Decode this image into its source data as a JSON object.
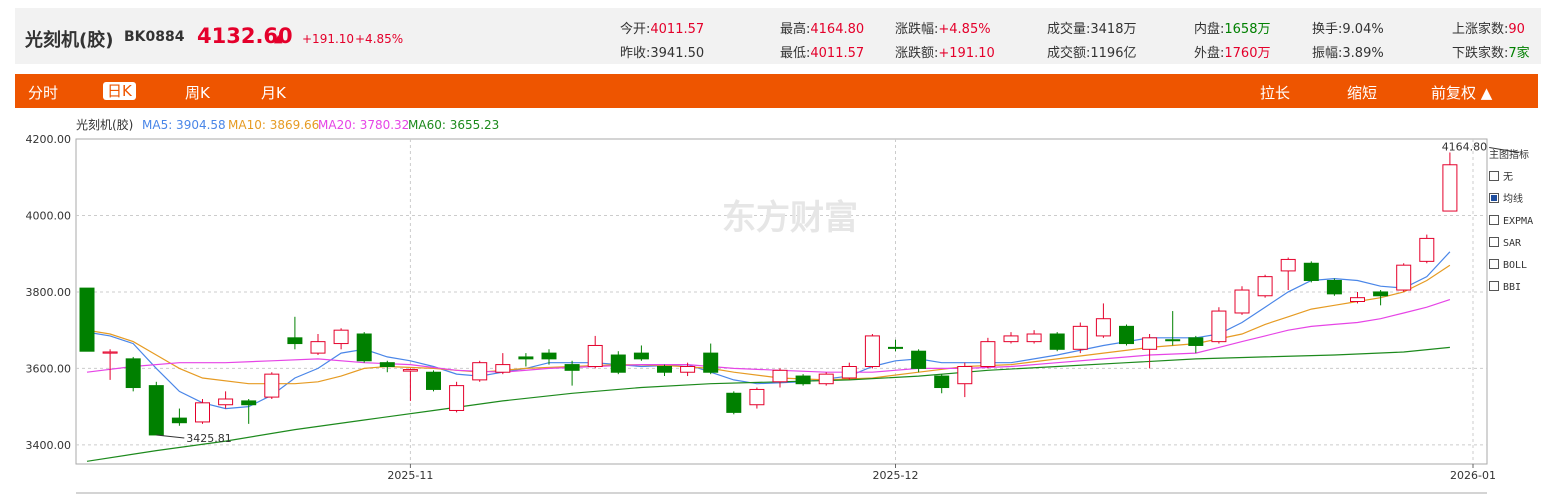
{
  "header": {
    "name": "光刻机(胶)",
    "code": "BK0884",
    "price": "4132.60",
    "arrow": "▲",
    "change": "+191.10",
    "change_pct": "+4.85%",
    "stats": [
      {
        "label": "今开:",
        "value": "4011.57",
        "tone": "red"
      },
      {
        "label": "昨收:",
        "value": "3941.50",
        "tone": "blk"
      },
      {
        "label": "最高:",
        "value": "4164.80",
        "tone": "red"
      },
      {
        "label": "最低:",
        "value": "4011.57",
        "tone": "red"
      },
      {
        "label": "涨跌幅:",
        "value": "+4.85%",
        "tone": "red"
      },
      {
        "label": "涨跌额:",
        "value": "+191.10",
        "tone": "red"
      },
      {
        "label": "成交量:",
        "value": "3418万",
        "tone": "blk"
      },
      {
        "label": "成交额:",
        "value": "1196亿",
        "tone": "blk"
      },
      {
        "label": "内盘:",
        "value": "1658万",
        "tone": "grn"
      },
      {
        "label": "外盘:",
        "value": "1760万",
        "tone": "red"
      },
      {
        "label": "换手:",
        "value": "9.04%",
        "tone": "blk"
      },
      {
        "label": "振幅:",
        "value": "3.89%",
        "tone": "blk"
      },
      {
        "label": "上涨家数:",
        "value": "90",
        "tone": "red"
      },
      {
        "label": "下跌家数:",
        "value": "7家",
        "tone": "grn"
      }
    ]
  },
  "tabs": {
    "left": [
      "分时",
      "日K",
      "周K",
      "月K"
    ],
    "active": "日K",
    "right": [
      "拉长",
      "缩短",
      "前复权 ▲"
    ]
  },
  "legend": {
    "name": "光刻机(胶)",
    "items": [
      {
        "label": "MA5: 3904.58",
        "color": "#4a86e8"
      },
      {
        "label": "MA10: 3869.66",
        "color": "#e69b23"
      },
      {
        "label": "MA20: 3780.32",
        "color": "#e645e6"
      },
      {
        "label": "MA60: 3655.23",
        "color": "#1d8a1d"
      }
    ]
  },
  "watermark": "东方财富",
  "panel": {
    "title": "主图指标",
    "options": [
      {
        "label": "无",
        "checked": false
      },
      {
        "label": "均线",
        "checked": true
      },
      {
        "label": "EXPMA",
        "checked": false
      },
      {
        "label": "SAR",
        "checked": false
      },
      {
        "label": "BOLL",
        "checked": false
      },
      {
        "label": "BBI",
        "checked": false
      }
    ]
  },
  "colors": {
    "up": "#e4002b",
    "down": "#008000",
    "accent": "#ee5500"
  },
  "chart_data": {
    "type": "candlestick",
    "ylim": [
      3350,
      4200
    ],
    "yticks": [
      3400,
      3600,
      3800,
      4000,
      4200
    ],
    "ytick_labels": [
      "3400.00",
      "3600.00",
      "3800.00",
      "4000.00",
      "4200.00"
    ],
    "xtick_labels": [
      {
        "label": "2025-11",
        "index": 14
      },
      {
        "label": "2025-12",
        "index": 35
      },
      {
        "label": "2026-01",
        "index": 60
      }
    ],
    "annotations": [
      {
        "text": "3425.81",
        "index": 3,
        "value": 3425.81
      },
      {
        "text": "4164.80",
        "index": 62,
        "value": 4164.8
      }
    ],
    "candles": [
      {
        "o": 3810,
        "c": 3645,
        "h": 3810,
        "l": 3645
      },
      {
        "o": 3640,
        "c": 3643,
        "h": 3650,
        "l": 3570
      },
      {
        "o": 3625,
        "c": 3550,
        "h": 3630,
        "l": 3540
      },
      {
        "o": 3555,
        "c": 3426,
        "h": 3565,
        "l": 3426
      },
      {
        "o": 3470,
        "c": 3458,
        "h": 3495,
        "l": 3450
      },
      {
        "o": 3460,
        "c": 3510,
        "h": 3520,
        "l": 3455
      },
      {
        "o": 3505,
        "c": 3520,
        "h": 3540,
        "l": 3495
      },
      {
        "o": 3515,
        "c": 3505,
        "h": 3520,
        "l": 3455
      },
      {
        "o": 3525,
        "c": 3585,
        "h": 3590,
        "l": 3520
      },
      {
        "o": 3680,
        "c": 3665,
        "h": 3735,
        "l": 3650
      },
      {
        "o": 3640,
        "c": 3670,
        "h": 3690,
        "l": 3635
      },
      {
        "o": 3665,
        "c": 3700,
        "h": 3705,
        "l": 3650
      },
      {
        "o": 3690,
        "c": 3620,
        "h": 3695,
        "l": 3615
      },
      {
        "o": 3615,
        "c": 3605,
        "h": 3620,
        "l": 3590
      },
      {
        "o": 3593,
        "c": 3597,
        "h": 3600,
        "l": 3515
      },
      {
        "o": 3590,
        "c": 3545,
        "h": 3595,
        "l": 3540
      },
      {
        "o": 3490,
        "c": 3555,
        "h": 3565,
        "l": 3485
      },
      {
        "o": 3570,
        "c": 3615,
        "h": 3620,
        "l": 3565
      },
      {
        "o": 3590,
        "c": 3610,
        "h": 3640,
        "l": 3585
      },
      {
        "o": 3630,
        "c": 3625,
        "h": 3640,
        "l": 3605
      },
      {
        "o": 3640,
        "c": 3625,
        "h": 3650,
        "l": 3610
      },
      {
        "o": 3610,
        "c": 3595,
        "h": 3620,
        "l": 3555
      },
      {
        "o": 3605,
        "c": 3660,
        "h": 3685,
        "l": 3600
      },
      {
        "o": 3635,
        "c": 3590,
        "h": 3645,
        "l": 3585
      },
      {
        "o": 3640,
        "c": 3625,
        "h": 3660,
        "l": 3620
      },
      {
        "o": 3605,
        "c": 3590,
        "h": 3610,
        "l": 3580
      },
      {
        "o": 3590,
        "c": 3605,
        "h": 3615,
        "l": 3580
      },
      {
        "o": 3640,
        "c": 3590,
        "h": 3665,
        "l": 3585
      },
      {
        "o": 3535,
        "c": 3485,
        "h": 3540,
        "l": 3480
      },
      {
        "o": 3505,
        "c": 3545,
        "h": 3550,
        "l": 3495
      },
      {
        "o": 3565,
        "c": 3595,
        "h": 3600,
        "l": 3550
      },
      {
        "o": 3580,
        "c": 3560,
        "h": 3585,
        "l": 3555
      },
      {
        "o": 3560,
        "c": 3585,
        "h": 3590,
        "l": 3555
      },
      {
        "o": 3575,
        "c": 3605,
        "h": 3615,
        "l": 3570
      },
      {
        "o": 3605,
        "c": 3685,
        "h": 3690,
        "l": 3600
      },
      {
        "o": 3655,
        "c": 3653,
        "h": 3675,
        "l": 3645
      },
      {
        "o": 3645,
        "c": 3600,
        "h": 3650,
        "l": 3590
      },
      {
        "o": 3580,
        "c": 3550,
        "h": 3585,
        "l": 3535
      },
      {
        "o": 3560,
        "c": 3605,
        "h": 3615,
        "l": 3525
      },
      {
        "o": 3605,
        "c": 3670,
        "h": 3680,
        "l": 3600
      },
      {
        "o": 3670,
        "c": 3685,
        "h": 3695,
        "l": 3665
      },
      {
        "o": 3670,
        "c": 3690,
        "h": 3700,
        "l": 3665
      },
      {
        "o": 3690,
        "c": 3650,
        "h": 3695,
        "l": 3645
      },
      {
        "o": 3650,
        "c": 3710,
        "h": 3720,
        "l": 3640
      },
      {
        "o": 3685,
        "c": 3730,
        "h": 3770,
        "l": 3680
      },
      {
        "o": 3710,
        "c": 3665,
        "h": 3715,
        "l": 3660
      },
      {
        "o": 3650,
        "c": 3680,
        "h": 3690,
        "l": 3600
      },
      {
        "o": 3675,
        "c": 3673,
        "h": 3750,
        "l": 3660
      },
      {
        "o": 3680,
        "c": 3660,
        "h": 3685,
        "l": 3640
      },
      {
        "o": 3670,
        "c": 3750,
        "h": 3760,
        "l": 3665
      },
      {
        "o": 3745,
        "c": 3805,
        "h": 3815,
        "l": 3740
      },
      {
        "o": 3790,
        "c": 3840,
        "h": 3845,
        "l": 3785
      },
      {
        "o": 3855,
        "c": 3885,
        "h": 3890,
        "l": 3805
      },
      {
        "o": 3875,
        "c": 3830,
        "h": 3880,
        "l": 3825
      },
      {
        "o": 3830,
        "c": 3795,
        "h": 3835,
        "l": 3790
      },
      {
        "o": 3775,
        "c": 3785,
        "h": 3800,
        "l": 3770
      },
      {
        "o": 3800,
        "c": 3790,
        "h": 3805,
        "l": 3765
      },
      {
        "o": 3805,
        "c": 3870,
        "h": 3875,
        "l": 3800
      },
      {
        "o": 3880,
        "c": 3940,
        "h": 3950,
        "l": 3875
      },
      {
        "o": 4011.57,
        "c": 4132.6,
        "h": 4164.8,
        "l": 4011.57
      }
    ],
    "ma": [
      {
        "name": "MA5",
        "color": "#4a86e8",
        "pts": [
          [
            0,
            3695
          ],
          [
            1,
            3685
          ],
          [
            2,
            3665
          ],
          [
            3,
            3600
          ],
          [
            4,
            3540
          ],
          [
            5,
            3510
          ],
          [
            6,
            3495
          ],
          [
            7,
            3500
          ],
          [
            8,
            3530
          ],
          [
            9,
            3575
          ],
          [
            10,
            3600
          ],
          [
            11,
            3640
          ],
          [
            12,
            3650
          ],
          [
            13,
            3630
          ],
          [
            14,
            3620
          ],
          [
            15,
            3605
          ],
          [
            16,
            3585
          ],
          [
            17,
            3580
          ],
          [
            18,
            3590
          ],
          [
            19,
            3600
          ],
          [
            20,
            3615
          ],
          [
            22,
            3615
          ],
          [
            24,
            3605
          ],
          [
            26,
            3610
          ],
          [
            27,
            3590
          ],
          [
            28,
            3570
          ],
          [
            29,
            3560
          ],
          [
            31,
            3565
          ],
          [
            33,
            3580
          ],
          [
            34,
            3605
          ],
          [
            35,
            3620
          ],
          [
            36,
            3625
          ],
          [
            37,
            3615
          ],
          [
            38,
            3615
          ],
          [
            40,
            3615
          ],
          [
            42,
            3635
          ],
          [
            44,
            3660
          ],
          [
            46,
            3680
          ],
          [
            48,
            3680
          ],
          [
            49,
            3690
          ],
          [
            50,
            3720
          ],
          [
            51,
            3760
          ],
          [
            52,
            3800
          ],
          [
            53,
            3830
          ],
          [
            54,
            3835
          ],
          [
            55,
            3830
          ],
          [
            56,
            3815
          ],
          [
            57,
            3810
          ],
          [
            58,
            3840
          ],
          [
            59,
            3905
          ]
        ]
      },
      {
        "name": "MA10",
        "color": "#e69b23",
        "pts": [
          [
            0,
            3700
          ],
          [
            1,
            3690
          ],
          [
            2,
            3670
          ],
          [
            3,
            3635
          ],
          [
            4,
            3600
          ],
          [
            5,
            3575
          ],
          [
            7,
            3560
          ],
          [
            9,
            3560
          ],
          [
            10,
            3565
          ],
          [
            11,
            3580
          ],
          [
            12,
            3600
          ],
          [
            13,
            3605
          ],
          [
            15,
            3600
          ],
          [
            17,
            3590
          ],
          [
            19,
            3600
          ],
          [
            21,
            3605
          ],
          [
            23,
            3610
          ],
          [
            25,
            3608
          ],
          [
            27,
            3600
          ],
          [
            28,
            3590
          ],
          [
            30,
            3575
          ],
          [
            32,
            3570
          ],
          [
            34,
            3575
          ],
          [
            36,
            3590
          ],
          [
            38,
            3605
          ],
          [
            40,
            3610
          ],
          [
            42,
            3625
          ],
          [
            44,
            3640
          ],
          [
            46,
            3655
          ],
          [
            48,
            3665
          ],
          [
            50,
            3690
          ],
          [
            51,
            3715
          ],
          [
            52,
            3735
          ],
          [
            53,
            3755
          ],
          [
            54,
            3765
          ],
          [
            55,
            3775
          ],
          [
            56,
            3785
          ],
          [
            57,
            3800
          ],
          [
            58,
            3830
          ],
          [
            59,
            3870
          ]
        ]
      },
      {
        "name": "MA20",
        "color": "#e645e6",
        "pts": [
          [
            0,
            3590
          ],
          [
            2,
            3605
          ],
          [
            4,
            3615
          ],
          [
            6,
            3615
          ],
          [
            8,
            3620
          ],
          [
            10,
            3625
          ],
          [
            12,
            3615
          ],
          [
            14,
            3610
          ],
          [
            16,
            3595
          ],
          [
            18,
            3590
          ],
          [
            20,
            3600
          ],
          [
            22,
            3605
          ],
          [
            24,
            3610
          ],
          [
            26,
            3610
          ],
          [
            28,
            3600
          ],
          [
            30,
            3595
          ],
          [
            32,
            3590
          ],
          [
            34,
            3590
          ],
          [
            36,
            3600
          ],
          [
            38,
            3600
          ],
          [
            40,
            3605
          ],
          [
            42,
            3615
          ],
          [
            44,
            3625
          ],
          [
            46,
            3635
          ],
          [
            48,
            3640
          ],
          [
            49,
            3655
          ],
          [
            50,
            3670
          ],
          [
            51,
            3685
          ],
          [
            52,
            3700
          ],
          [
            53,
            3710
          ],
          [
            54,
            3715
          ],
          [
            55,
            3720
          ],
          [
            56,
            3730
          ],
          [
            57,
            3745
          ],
          [
            58,
            3760
          ],
          [
            59,
            3780
          ]
        ]
      },
      {
        "name": "MA60",
        "color": "#1d8a1d",
        "pts": [
          [
            0,
            3357
          ],
          [
            3,
            3385
          ],
          [
            6,
            3410
          ],
          [
            9,
            3440
          ],
          [
            12,
            3465
          ],
          [
            15,
            3490
          ],
          [
            18,
            3515
          ],
          [
            21,
            3535
          ],
          [
            24,
            3550
          ],
          [
            27,
            3560
          ],
          [
            30,
            3565
          ],
          [
            33,
            3570
          ],
          [
            36,
            3580
          ],
          [
            39,
            3595
          ],
          [
            42,
            3605
          ],
          [
            45,
            3615
          ],
          [
            48,
            3625
          ],
          [
            51,
            3630
          ],
          [
            54,
            3635
          ],
          [
            57,
            3643
          ],
          [
            59,
            3655
          ]
        ]
      }
    ]
  }
}
